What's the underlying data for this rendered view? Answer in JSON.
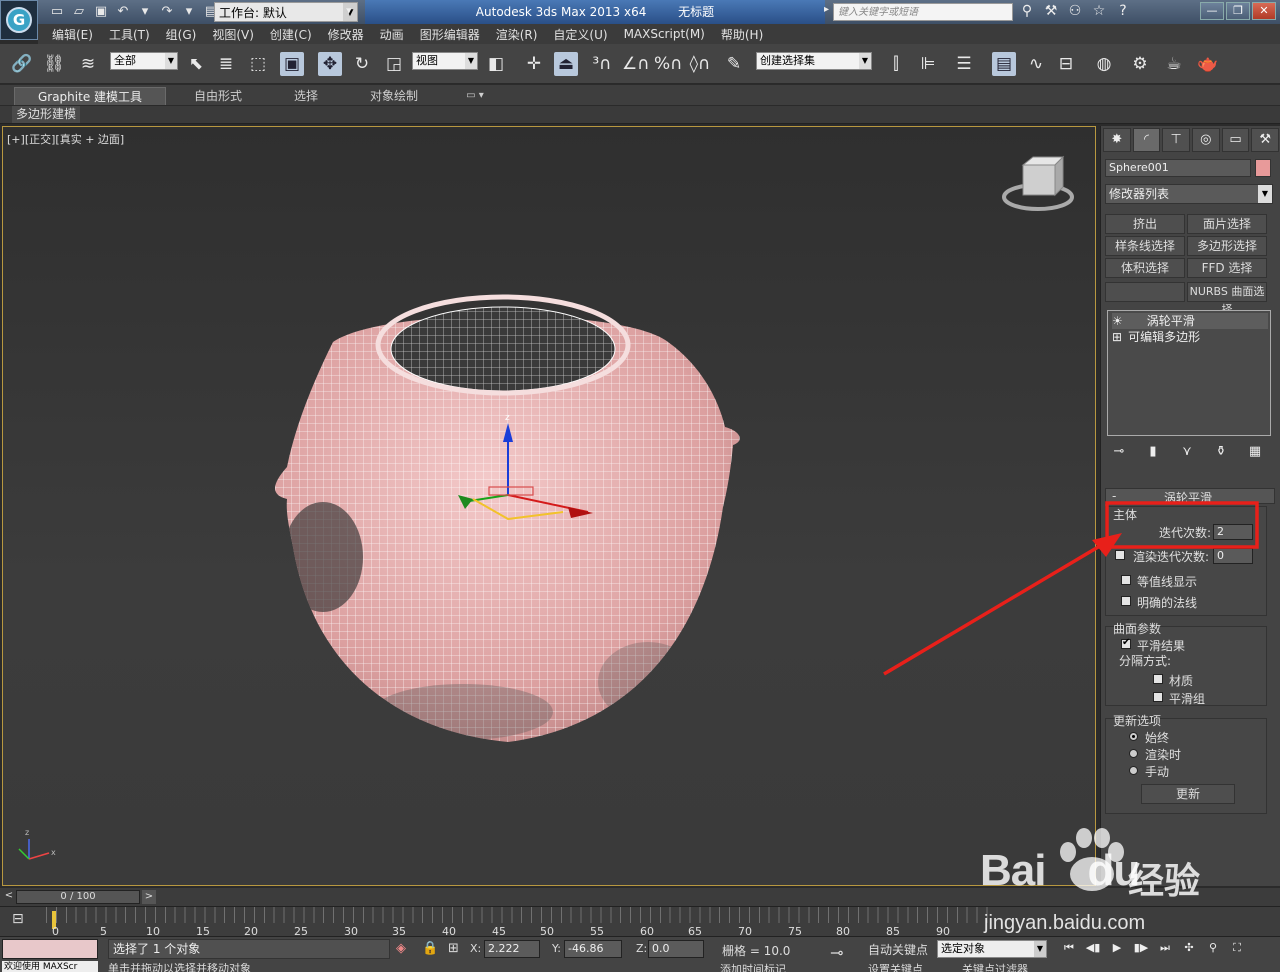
{
  "app": {
    "workspace_label": "工作台: 默认",
    "title_app": "Autodesk 3ds Max  2013 x64",
    "title_doc": "无标题",
    "search_placeholder": "键入关键字或短语"
  },
  "menu": [
    "编辑(E)",
    "工具(T)",
    "组(G)",
    "视图(V)",
    "创建(C)",
    "修改器",
    "动画",
    "图形编辑器",
    "渲染(R)",
    "自定义(U)",
    "MAXScript(M)",
    "帮助(H)"
  ],
  "toolbar": {
    "selection_filter": "全部",
    "ref_coord": "视图",
    "named_selection": "创建选择集"
  },
  "ribbon": {
    "tabs": [
      "Graphite 建模工具",
      "自由形式",
      "选择",
      "对象绘制"
    ],
    "sub_label": "多边形建模"
  },
  "viewport": {
    "label_plus": "[+]",
    "label_view": "[正交]",
    "label_shading": "[真实 + 边面]"
  },
  "command_panel": {
    "object_name": "Sphere001",
    "object_color": "#e89a9a",
    "modifier_list": "修改器列表",
    "modifier_buttons": [
      "挤出",
      "面片选择",
      "样条线选择",
      "多边形选择",
      "体积选择",
      "FFD 选择",
      "",
      "NURBS 曲面选择"
    ],
    "stack": [
      "涡轮平滑",
      "可编辑多边形"
    ],
    "rollout_title": "涡轮平滑",
    "main_group": "主体",
    "iterations_label": "迭代次数:",
    "iterations_value": "2",
    "render_iters_label": "渲染迭代次数:",
    "render_iters_value": "0",
    "isoline_label": "等值线显示",
    "explicit_normals_label": "明确的法线",
    "surface_group": "曲面参数",
    "smooth_result_label": "平滑结果",
    "separate_by_label": "分隔方式:",
    "materials_label": "材质",
    "smoothing_groups_label": "平滑组",
    "update_group": "更新选项",
    "update_always": "始终",
    "update_render": "渲染时",
    "update_manual": "手动",
    "update_button": "更新"
  },
  "timeline": {
    "frame": "0 / 100",
    "ticks": [
      "0",
      "5",
      "10",
      "15",
      "20",
      "25",
      "30",
      "35",
      "40",
      "45",
      "50",
      "55",
      "60",
      "65",
      "70",
      "75",
      "80",
      "85",
      "90"
    ]
  },
  "status": {
    "maxscript": "欢迎使用 MAXScr",
    "selection_msg": "选择了 1 个对象",
    "prompt_msg": "单击并拖动以选择并移动对象",
    "x": "2.222",
    "y": "-46.86",
    "z": "0.0",
    "grid": "栅格 = 10.0",
    "auto_key": "自动关键点",
    "set_key": "设置关键点",
    "selected_object": "选定对象",
    "key_filters": "关键点过滤器",
    "add_time_tag": "添加时间标记"
  },
  "watermark": {
    "brand": "Bai",
    "brand2": "du",
    "cn": "经验",
    "url": "jingyan.baidu.com"
  },
  "annotation_color": "#e8201a"
}
